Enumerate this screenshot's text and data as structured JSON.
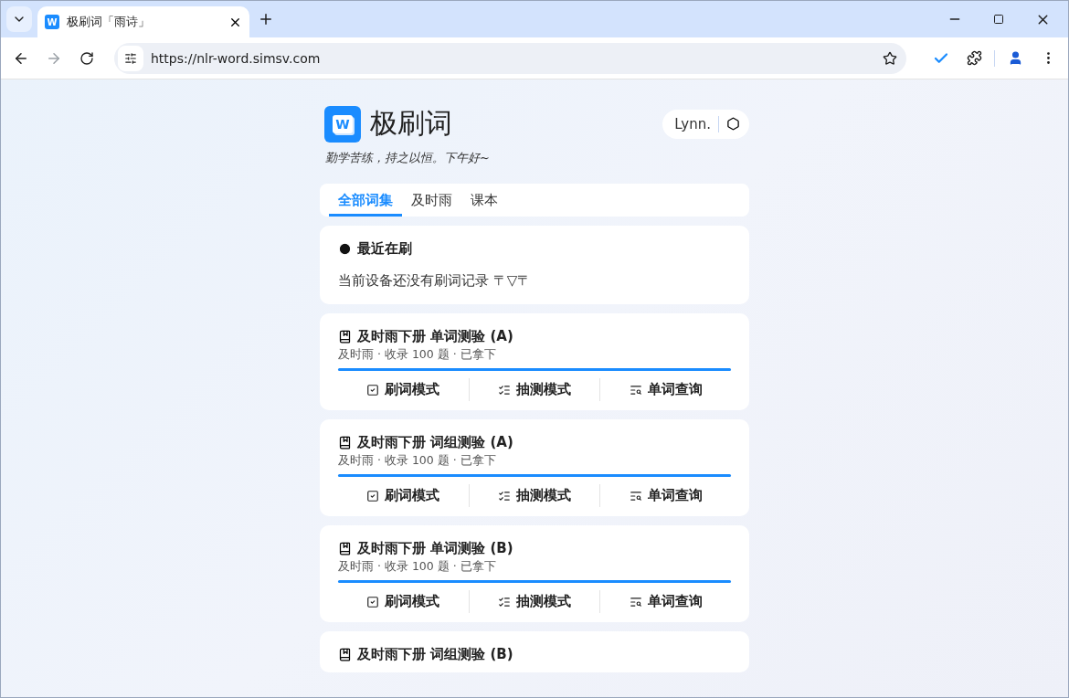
{
  "browser": {
    "favicon_letter": "W",
    "tab_title": "极刷词「雨诗」",
    "url": "https://nlr-word.simsv.com"
  },
  "app": {
    "logo_letter": "W",
    "title": "极刷词",
    "user": "Lynn.",
    "tagline": "勤学苦练，持之以恒。下午好~"
  },
  "tabs": [
    {
      "label": "全部词集",
      "selected": true
    },
    {
      "label": "及时雨",
      "selected": false
    },
    {
      "label": "课本",
      "selected": false
    }
  ],
  "recent": {
    "title": "最近在刷",
    "empty_text": "当前设备还没有刷词记录 〒▽〒"
  },
  "sets": [
    {
      "title": "及时雨下册 单词测验 (A)",
      "meta": "及时雨 · 收录 100 题 · 已拿下",
      "level": 1,
      "actions": [
        {
          "kind": "drill",
          "label": "刷词模式"
        },
        {
          "kind": "quiz",
          "label": "抽测模式"
        },
        {
          "kind": "lookup",
          "label": "单词查询"
        }
      ]
    },
    {
      "title": "及时雨下册 词组测验 (A)",
      "meta": "及时雨 · 收录 100 题 · 已拿下",
      "level": 1,
      "actions": [
        {
          "kind": "drill",
          "label": "刷词模式"
        },
        {
          "kind": "quiz",
          "label": "抽测模式"
        },
        {
          "kind": "lookup",
          "label": "单词查询"
        }
      ]
    },
    {
      "title": "及时雨下册 单词测验 (B)",
      "meta": "及时雨 · 收录 100 题 · 已拿下",
      "level": 1,
      "actions": [
        {
          "kind": "drill",
          "label": "刷词模式"
        },
        {
          "kind": "quiz",
          "label": "抽测模式"
        },
        {
          "kind": "lookup",
          "label": "单词查询"
        }
      ]
    },
    {
      "title": "及时雨下册 词组测验 (B)"
    }
  ]
}
